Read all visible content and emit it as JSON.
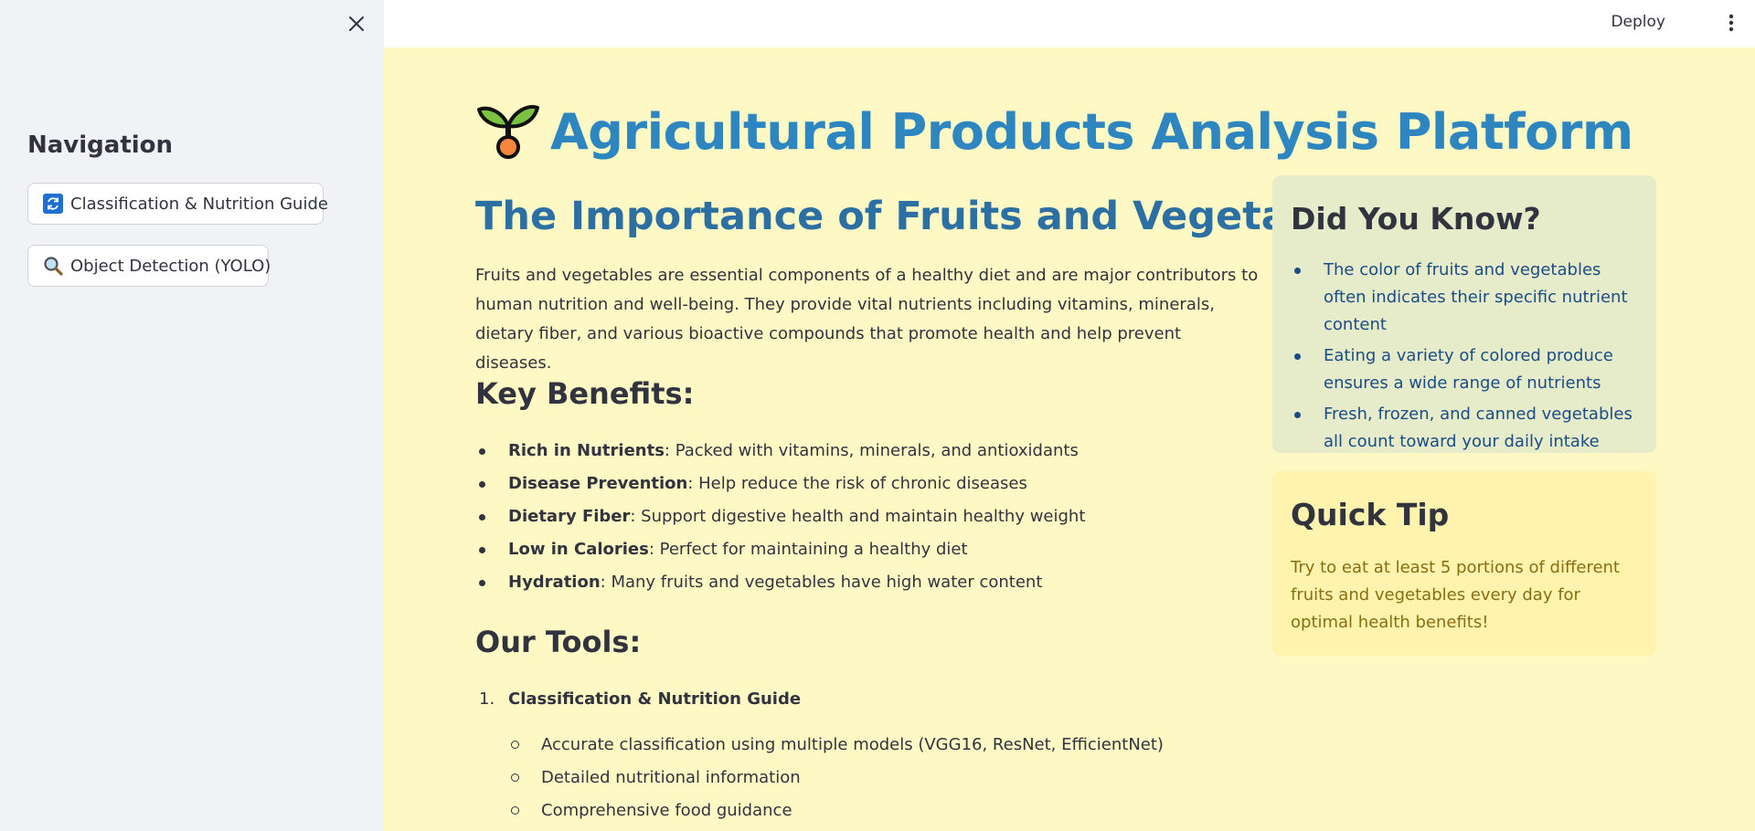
{
  "sidebar": {
    "title": "Navigation",
    "buttons": [
      {
        "label": "Classification & Nutrition Guide",
        "icon": "refresh-icon"
      },
      {
        "label": "Object Detection (YOLO)",
        "icon": "magnifier-icon"
      }
    ]
  },
  "header": {
    "deploy_label": "Deploy"
  },
  "main": {
    "title": "Agricultural Products Analysis Platform",
    "section_title": "The Importance of Fruits and Vegetables",
    "intro": "Fruits and vegetables are essential components of a healthy diet and are major contributors to human nutrition and well-being. They provide vital nutrients including vitamins, minerals, dietary fiber, and various bioactive compounds that promote health and help prevent diseases.",
    "benefits_title": "Key Benefits:",
    "benefits": [
      {
        "term": "Rich in Nutrients",
        "desc": ": Packed with vitamins, minerals, and antioxidants"
      },
      {
        "term": "Disease Prevention",
        "desc": ": Help reduce the risk of chronic diseases"
      },
      {
        "term": "Dietary Fiber",
        "desc": ": Support digestive health and maintain healthy weight"
      },
      {
        "term": "Low in Calories",
        "desc": ": Perfect for maintaining a healthy diet"
      },
      {
        "term": "Hydration",
        "desc": ": Many fruits and vegetables have high water content"
      }
    ],
    "tools_title": "Our Tools:",
    "tools": [
      {
        "number": "1.",
        "name": "Classification & Nutrition Guide",
        "features": [
          "Accurate classification using multiple models (VGG16, ResNet, EfficientNet)",
          "Detailed nutritional information",
          "Comprehensive food guidance"
        ]
      }
    ]
  },
  "cards": {
    "did_you_know": {
      "title": "Did You Know?",
      "items": [
        "The color of fruits and vegetables often indicates their specific nutrient content",
        "Eating a variety of colored produce ensures a wide range of nutrients",
        "Fresh, frozen, and canned vegetables all count toward your daily intake"
      ]
    },
    "quick_tip": {
      "title": "Quick Tip",
      "text": "Try to eat at least 5 portions of different fruits and vegetables every day for optimal health benefits!"
    }
  },
  "colors": {
    "main_bg": "#fef8c4",
    "sidebar_bg": "#f0f2f6",
    "title_blue": "#2e86c1",
    "section_blue": "#2c6fa3",
    "know_card_bg": "#e6ebca",
    "tip_card_bg": "#fff3ad"
  },
  "icons": {
    "title": "seedling-icon",
    "close": "close-icon",
    "menu": "more-vertical-icon"
  }
}
